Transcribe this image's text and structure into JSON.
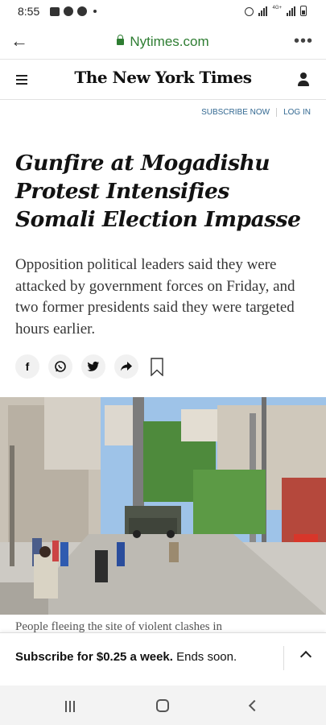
{
  "status_bar": {
    "time": "8:55",
    "network_label": "4G+"
  },
  "browser": {
    "url": "Nytimes.com",
    "back_icon": "arrow-left-icon",
    "lock_icon": "lock-icon",
    "menu_icon": "more-dots-icon"
  },
  "nyt_header": {
    "masthead": "The New York Times",
    "menu_icon": "hamburger-icon",
    "user_icon": "user-icon"
  },
  "subscribe_bar": {
    "subscribe_label": "SUBSCRIBE NOW",
    "login_label": "LOG IN"
  },
  "article": {
    "headline": "Gunfire at Mogadishu Protest Intensifies Somali Election Impasse",
    "summary": "Opposition political leaders said they were attacked by government forces on Friday, and two former presidents said they were targeted hours earlier.",
    "caption": "People fleeing the site of violent clashes in"
  },
  "share": {
    "facebook": "f",
    "whatsapp": "whatsapp-icon",
    "twitter": "twitter-icon",
    "share": "share-arrow-icon",
    "bookmark": "bookmark-icon"
  },
  "promo": {
    "bold_text": "Subscribe for $0.25 a week.",
    "rest_text": " Ends soon."
  },
  "colors": {
    "url_green": "#2e7d32",
    "link_blue": "#326891",
    "text_dark": "#121212"
  }
}
